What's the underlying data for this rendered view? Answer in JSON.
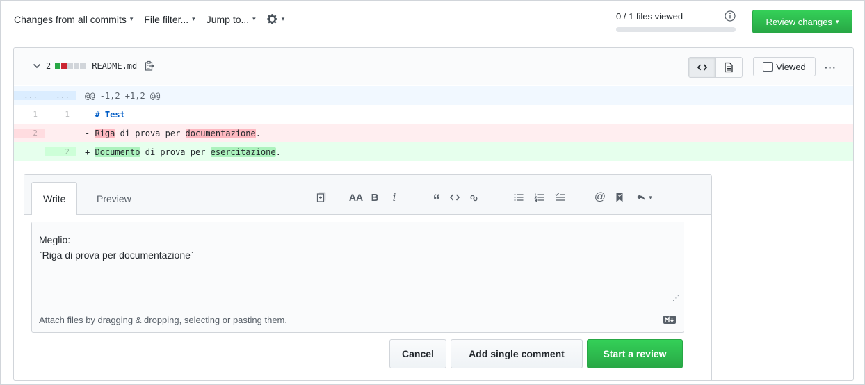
{
  "toolbar": {
    "changes_prefix": "Changes from",
    "changes_value": "all commits",
    "file_filter": "File filter...",
    "jump_to": "Jump to...",
    "caret": "▾"
  },
  "progress": {
    "label": "0 / 1 files viewed",
    "fraction": 0
  },
  "review_button": "Review changes",
  "file": {
    "diff_count": "2",
    "diffstat": [
      "#28a745",
      "#cb2431",
      "#d1d5da",
      "#d1d5da",
      "#d1d5da"
    ],
    "name": "README.md",
    "viewed_label": "Viewed",
    "more": "···"
  },
  "diff": {
    "hunk": {
      "old": "...",
      "new": "...",
      "text": "@@ -1,2 +1,2 @@"
    },
    "context": {
      "old": "1",
      "new": "1",
      "text": "# Test"
    },
    "deleted": {
      "old": "2",
      "sign": "-",
      "hl1": "Riga",
      "mid": " di prova per ",
      "hl2": "documentazione",
      "end": "."
    },
    "added": {
      "new": "2",
      "sign": "+",
      "hl1": "Documento",
      "mid": " di prova per ",
      "hl2": "esercitazione",
      "end": "."
    }
  },
  "comment": {
    "tab_write": "Write",
    "tab_preview": "Preview",
    "tools": {
      "heading": "AA",
      "bold": "B",
      "italic": "i",
      "quote": "“",
      "mention": "@"
    },
    "body": "Meglio:\n`Riga di prova per documentazione`",
    "attach_hint": "Attach files by dragging & dropping, selecting or pasting them.",
    "cancel": "Cancel",
    "add_single": "Add single comment",
    "start_review": "Start a review"
  }
}
